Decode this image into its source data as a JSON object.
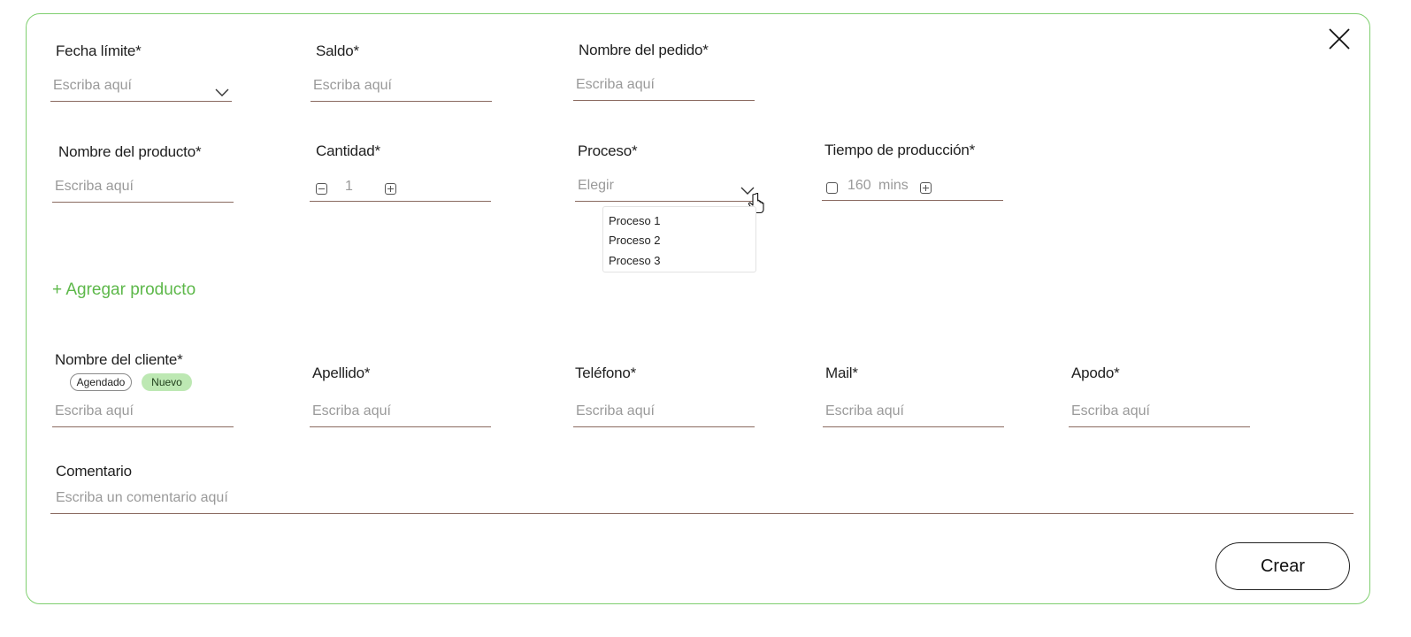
{
  "form": {
    "deadline": {
      "label": "Fecha límite*",
      "placeholder": "Escriba aquí"
    },
    "balance": {
      "label": "Saldo*",
      "placeholder": "Escriba aquí"
    },
    "order_name": {
      "label": "Nombre del pedido*",
      "placeholder": "Escriba aquí"
    },
    "product_name": {
      "label": "Nombre del producto*",
      "placeholder": "Escriba aquí"
    },
    "quantity": {
      "label": "Cantidad*",
      "value": "1"
    },
    "process": {
      "label": "Proceso*",
      "placeholder": "Elegir",
      "options": [
        "Proceso 1",
        "Proceso 2",
        "Proceso 3"
      ]
    },
    "production_time": {
      "label": "Tiempo de producción*",
      "value": "160",
      "unit": "mins"
    },
    "add_product_label": "+ Agregar producto",
    "client_name": {
      "label": "Nombre del cliente*",
      "placeholder": "Escriba aquí"
    },
    "client_tags": {
      "scheduled": "Agendado",
      "new": "Nuevo"
    },
    "last_name": {
      "label": "Apellido*",
      "placeholder": "Escriba aquí"
    },
    "phone": {
      "label": "Teléfono*",
      "placeholder": "Escriba aquí"
    },
    "mail": {
      "label": "Mail*",
      "placeholder": "Escriba aquí"
    },
    "nickname": {
      "label": "Apodo*",
      "placeholder": "Escriba aquí"
    },
    "comment": {
      "label": "Comentario",
      "placeholder": "Escriba un comentario aquí"
    },
    "create_label": "Crear"
  },
  "icons": {
    "close": "close-icon",
    "dropdown": "chevron-down-icon",
    "minus": "minus-square-icon",
    "plus": "plus-square-icon",
    "cursor": "hand-pointer-icon"
  },
  "colors": {
    "accent": "#5db84a",
    "modal_border": "#7fcf6f",
    "chip_new_bg": "#bde8b3",
    "field_underline": "#8a6a60"
  }
}
